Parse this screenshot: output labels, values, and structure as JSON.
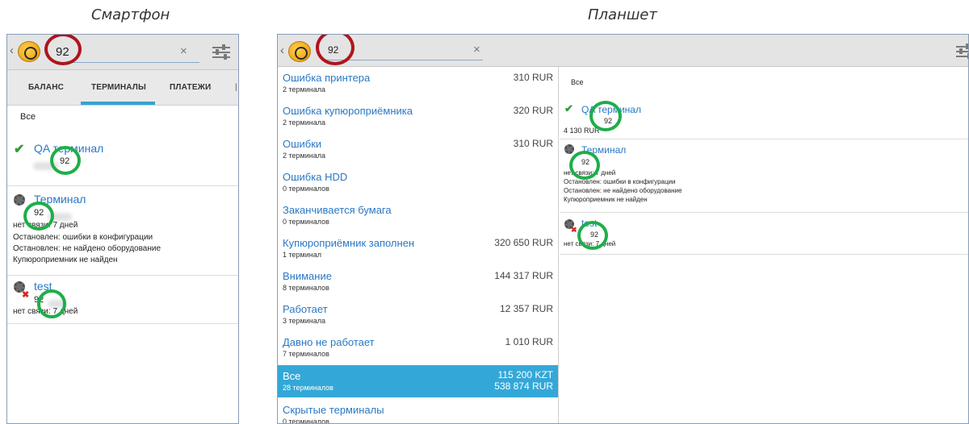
{
  "captions": {
    "phone": "Смартфон",
    "tablet": "Планшет"
  },
  "phone": {
    "search_value": "92",
    "clear_symbol": "×",
    "tabs": [
      {
        "label": "БАЛАНС"
      },
      {
        "label": "ТЕРМИНАЛЫ"
      },
      {
        "label": "ПЛАТЕЖИ"
      }
    ],
    "all_label": "Все",
    "terminals": [
      {
        "name": "QA терминал",
        "number": "92"
      },
      {
        "name": "Терминал",
        "number": "92",
        "lines": [
          "нет связи: 7 дней",
          "Остановлен: ошибки в конфигурации",
          "Остановлен: не найдено оборудование",
          "Купюроприемник не найден"
        ]
      },
      {
        "name": "test",
        "number": "92",
        "lines": [
          "нет связи: 7 дней"
        ]
      }
    ]
  },
  "tablet": {
    "search_value": "92",
    "clear_symbol": "×",
    "list": [
      {
        "name": "Ошибка принтера",
        "sub": "2 терминала",
        "amount": "310 RUR"
      },
      {
        "name": "Ошибка купюроприёмника",
        "sub": "2 терминала",
        "amount": "320 RUR"
      },
      {
        "name": "Ошибки",
        "sub": "2 терминала",
        "amount": "310 RUR"
      },
      {
        "name": "Ошибка HDD",
        "sub": "0 терминалов",
        "amount": ""
      },
      {
        "name": "Заканчивается бумага",
        "sub": "0 терминалов",
        "amount": ""
      },
      {
        "name": "Купюроприёмник заполнен",
        "sub": "1 терминал",
        "amount": "320 650 RUR"
      },
      {
        "name": "Внимание",
        "sub": "8 терминалов",
        "amount": "144 317 RUR"
      },
      {
        "name": "Работает",
        "sub": "3 терминала",
        "amount": "12 357 RUR"
      },
      {
        "name": "Давно не работает",
        "sub": "7 терминалов",
        "amount": "1 010 RUR"
      },
      {
        "name": "Все",
        "sub": "28 терминалов",
        "amount": "115 200 KZT",
        "amount2": "538 874 RUR"
      },
      {
        "name": "Скрытые терминалы",
        "sub": "0 терминалов",
        "amount": ""
      }
    ],
    "all_label": "Все",
    "terminals": [
      {
        "name": "QA терминал",
        "number": "92",
        "balance": "4 130 RUR"
      },
      {
        "name": "Терминал",
        "number": "92",
        "lines": [
          "нет связи: 7 дней",
          "Остановлен: ошибки в конфигурации",
          "Остановлен: не найдено оборудование",
          "Купюроприемник не найден"
        ]
      },
      {
        "name": "test",
        "number": "92",
        "lines": [
          "нет связи: 7 дней"
        ]
      }
    ]
  },
  "colors": {
    "accent": "#33a8d8",
    "link": "#2a78c4",
    "red_ring": "#b0141c",
    "green_ring": "#1eae4a",
    "check": "#2e9c3a"
  }
}
